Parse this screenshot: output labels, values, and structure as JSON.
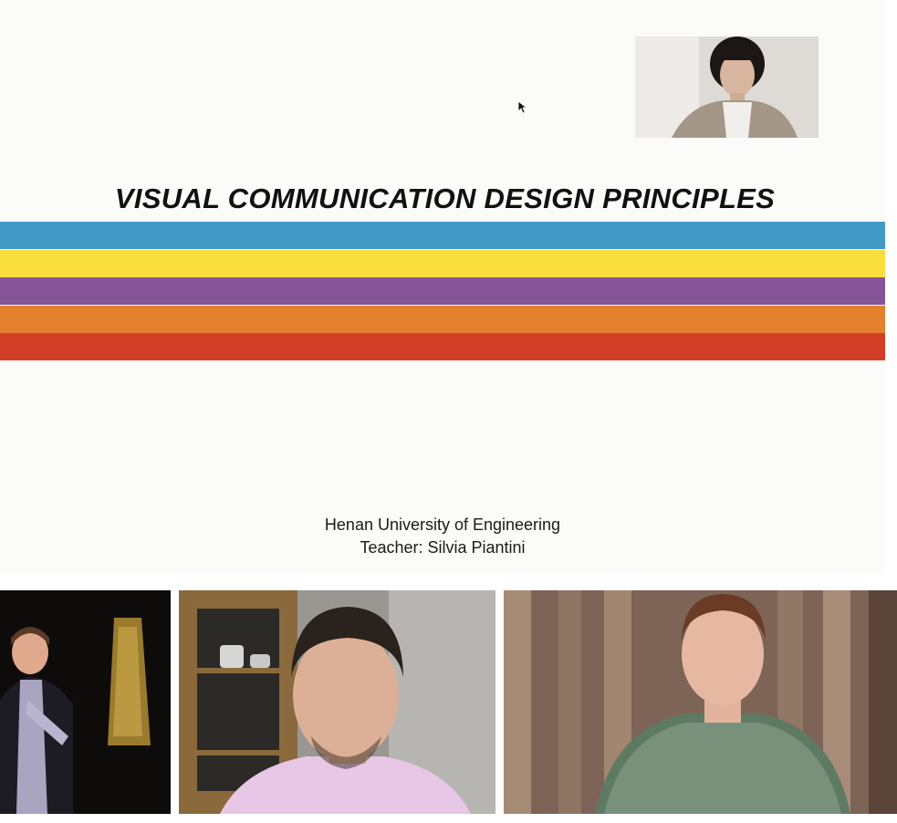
{
  "slide": {
    "title": "VISUAL COMMUNICATION DESIGN PRINCIPLES",
    "institution": "Henan University of Engineering",
    "teacher": "Teacher: Silvia Piantini",
    "stripe_colors": [
      "#4199c6",
      "#fadf3d",
      "#865597",
      "#e3812f",
      "#d33f26"
    ]
  },
  "participants": [
    {
      "tile": "presenter"
    },
    {
      "tile": "participant-1"
    },
    {
      "tile": "participant-2"
    },
    {
      "tile": "participant-3"
    }
  ]
}
